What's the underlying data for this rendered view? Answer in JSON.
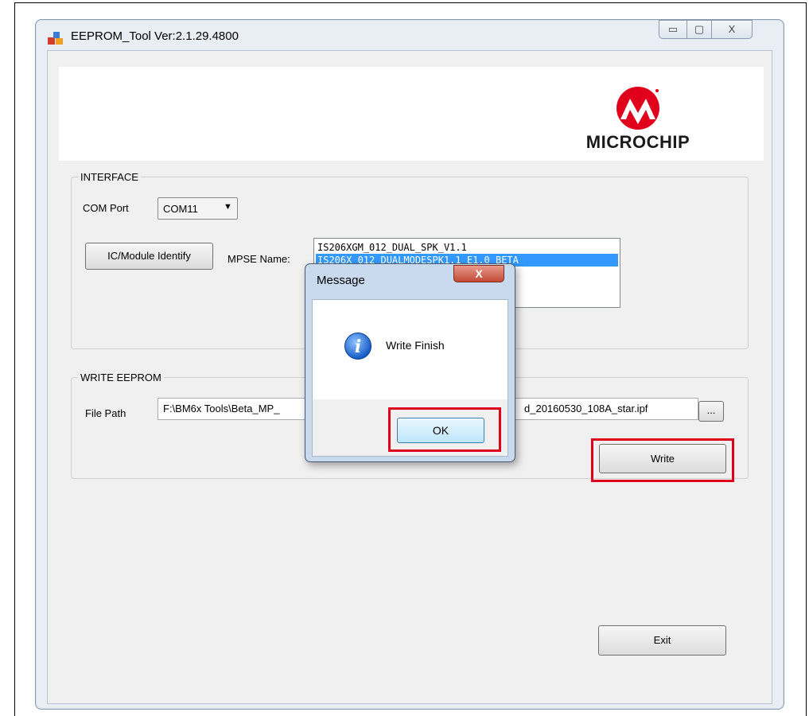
{
  "window": {
    "title": "EEPROM_Tool Ver:2.1.29.4800",
    "minimize_glyph": "▭",
    "maximize_glyph": "▢",
    "close_glyph": "X"
  },
  "banner": {
    "logo_text": "MICROCHIP",
    "logo_color": "#e0001b"
  },
  "interface": {
    "group_label": "INTERFACE",
    "com_port_label": "COM Port",
    "com_port_value": "COM11",
    "identify_button": "IC/Module Identify",
    "mpse_label": "MPSE Name:",
    "mpse_items": [
      {
        "label": "IS206XGM_012_DUAL_SPK_V1.1",
        "selected": false
      },
      {
        "label": "IS206X_012_DUALMODESPK1.1_E1.0_BETA",
        "selected": true
      }
    ]
  },
  "write_eeprom": {
    "group_label": "WRITE EEPROM",
    "file_path_label": "File Path",
    "file_path_left": "F:\\BM6x Tools\\Beta_MP_",
    "file_path_right": "d_20160530_108A_star.ipf",
    "browse_button": "...",
    "write_button": "Write"
  },
  "exit_button": "Exit",
  "dialog": {
    "title": "Message",
    "close_glyph": "X",
    "icon": "info-icon",
    "message": "Write Finish",
    "ok_button": "OK"
  },
  "colors": {
    "annotation_red": "#e0001b",
    "selection_blue": "#3399ff"
  }
}
